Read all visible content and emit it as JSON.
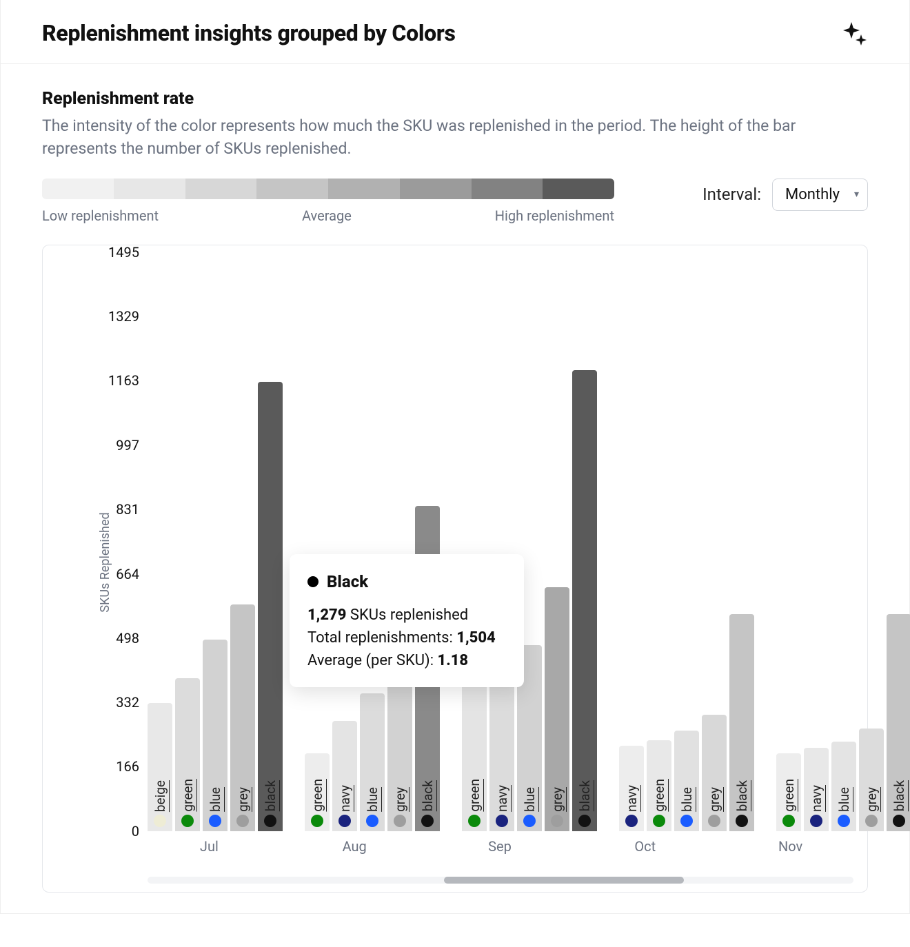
{
  "header": {
    "title": "Replenishment insights grouped by Colors"
  },
  "section": {
    "title": "Replenishment rate",
    "description": "The intensity of the color represents how much the SKU was replenished in the period. The height of the bar represents the number of SKUs replenished."
  },
  "legend": {
    "low": "Low replenishment",
    "mid": "Average",
    "high": "High replenishment",
    "shades": [
      "#f1f1f1",
      "#e7e7e7",
      "#d7d7d7",
      "#c5c5c5",
      "#b1b1b1",
      "#9b9b9b",
      "#828282",
      "#5a5a5a"
    ]
  },
  "interval": {
    "label": "Interval:",
    "value": "Monthly"
  },
  "tooltip": {
    "color_name": "Black",
    "skus_replenished": "1,279",
    "skus_label": "SKUs replenished",
    "total_label": "Total replenishments:",
    "total_value": "1,504",
    "avg_label": "Average (per SKU):",
    "avg_value": "1.18"
  },
  "chart_data": {
    "type": "bar",
    "ylabel": "SKUs Replenished",
    "ylim": [
      0,
      1495
    ],
    "yticks": [
      0,
      166,
      332,
      498,
      664,
      831,
      997,
      1163,
      1329,
      1495
    ],
    "categories": [
      "Jul",
      "Aug",
      "Sep",
      "Oct",
      "Nov"
    ],
    "series_meta": {
      "beige": {
        "swatch": "#eeecd5"
      },
      "green": {
        "swatch": "#0b8a0b"
      },
      "navy": {
        "swatch": "#1a237e"
      },
      "blue": {
        "swatch": "#1a5cff"
      },
      "grey": {
        "swatch": "#9e9e9e"
      },
      "black": {
        "swatch": "#111111"
      }
    },
    "groups": [
      {
        "month": "Jul",
        "bars": [
          {
            "color": "beige",
            "value": 330,
            "fill": "#e8e8e8"
          },
          {
            "color": "green",
            "value": 395,
            "fill": "#dcdcdc"
          },
          {
            "color": "blue",
            "value": 495,
            "fill": "#d2d2d2"
          },
          {
            "color": "grey",
            "value": 585,
            "fill": "#c5c5c5"
          },
          {
            "color": "black",
            "value": 1160,
            "fill": "#5a5a5a"
          }
        ]
      },
      {
        "month": "Aug",
        "bars": [
          {
            "color": "green",
            "value": 200,
            "fill": "#ededed"
          },
          {
            "color": "navy",
            "value": 285,
            "fill": "#e4e4e4"
          },
          {
            "color": "blue",
            "value": 355,
            "fill": "#dcdcdc"
          },
          {
            "color": "grey",
            "value": 415,
            "fill": "#d2d2d2"
          },
          {
            "color": "black",
            "value": 840,
            "fill": "#8a8a8a"
          }
        ]
      },
      {
        "month": "Sep",
        "bars": [
          {
            "color": "green",
            "value": 380,
            "fill": "#e4e4e4"
          },
          {
            "color": "navy",
            "value": 455,
            "fill": "#dcdcdc"
          },
          {
            "color": "blue",
            "value": 480,
            "fill": "#d2d2d2"
          },
          {
            "color": "grey",
            "value": 630,
            "fill": "#a8a8a8"
          },
          {
            "color": "black",
            "value": 1190,
            "fill": "#5a5a5a"
          }
        ]
      },
      {
        "month": "Oct",
        "bars": [
          {
            "color": "navy",
            "value": 220,
            "fill": "#ededed"
          },
          {
            "color": "green",
            "value": 235,
            "fill": "#e8e8e8"
          },
          {
            "color": "blue",
            "value": 260,
            "fill": "#e1e1e1"
          },
          {
            "color": "grey",
            "value": 300,
            "fill": "#d8d8d8"
          },
          {
            "color": "black",
            "value": 560,
            "fill": "#c5c5c5"
          }
        ]
      },
      {
        "month": "Nov",
        "bars": [
          {
            "color": "green",
            "value": 200,
            "fill": "#ededed"
          },
          {
            "color": "navy",
            "value": 215,
            "fill": "#e8e8e8"
          },
          {
            "color": "blue",
            "value": 230,
            "fill": "#e4e4e4"
          },
          {
            "color": "grey",
            "value": 265,
            "fill": "#dcdcdc"
          },
          {
            "color": "black",
            "value": 560,
            "fill": "#c5c5c5"
          }
        ]
      }
    ]
  }
}
